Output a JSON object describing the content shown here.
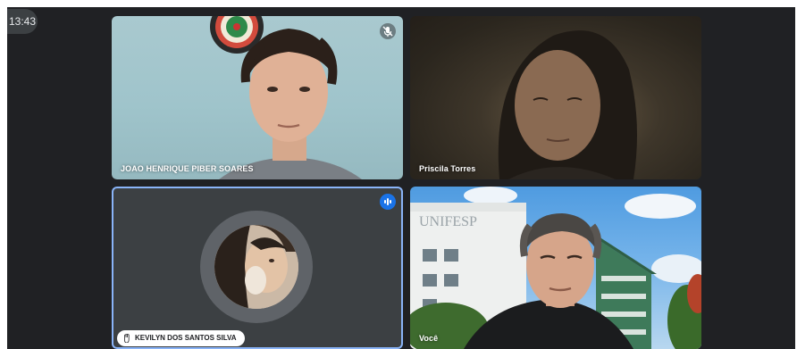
{
  "clock": {
    "time": "13:43"
  },
  "participants": [
    {
      "name": "JOAO HENRIQUE PIBER SOARES",
      "muted": true
    },
    {
      "name": "Priscila Torres"
    },
    {
      "name": "KEVILYN DOS SANTOS SILVA",
      "speaking": true
    },
    {
      "name": "Você"
    }
  ],
  "background_sign": "UNIFESP",
  "icons": {
    "mute": "mic-off-icon",
    "speaking": "audio-level-icon",
    "hand": "raised-hand-icon"
  },
  "colors": {
    "stage": "#202124",
    "tile": "#3c4043",
    "active_border": "#8ab4f8",
    "speaking_badge": "#1a73e8"
  }
}
